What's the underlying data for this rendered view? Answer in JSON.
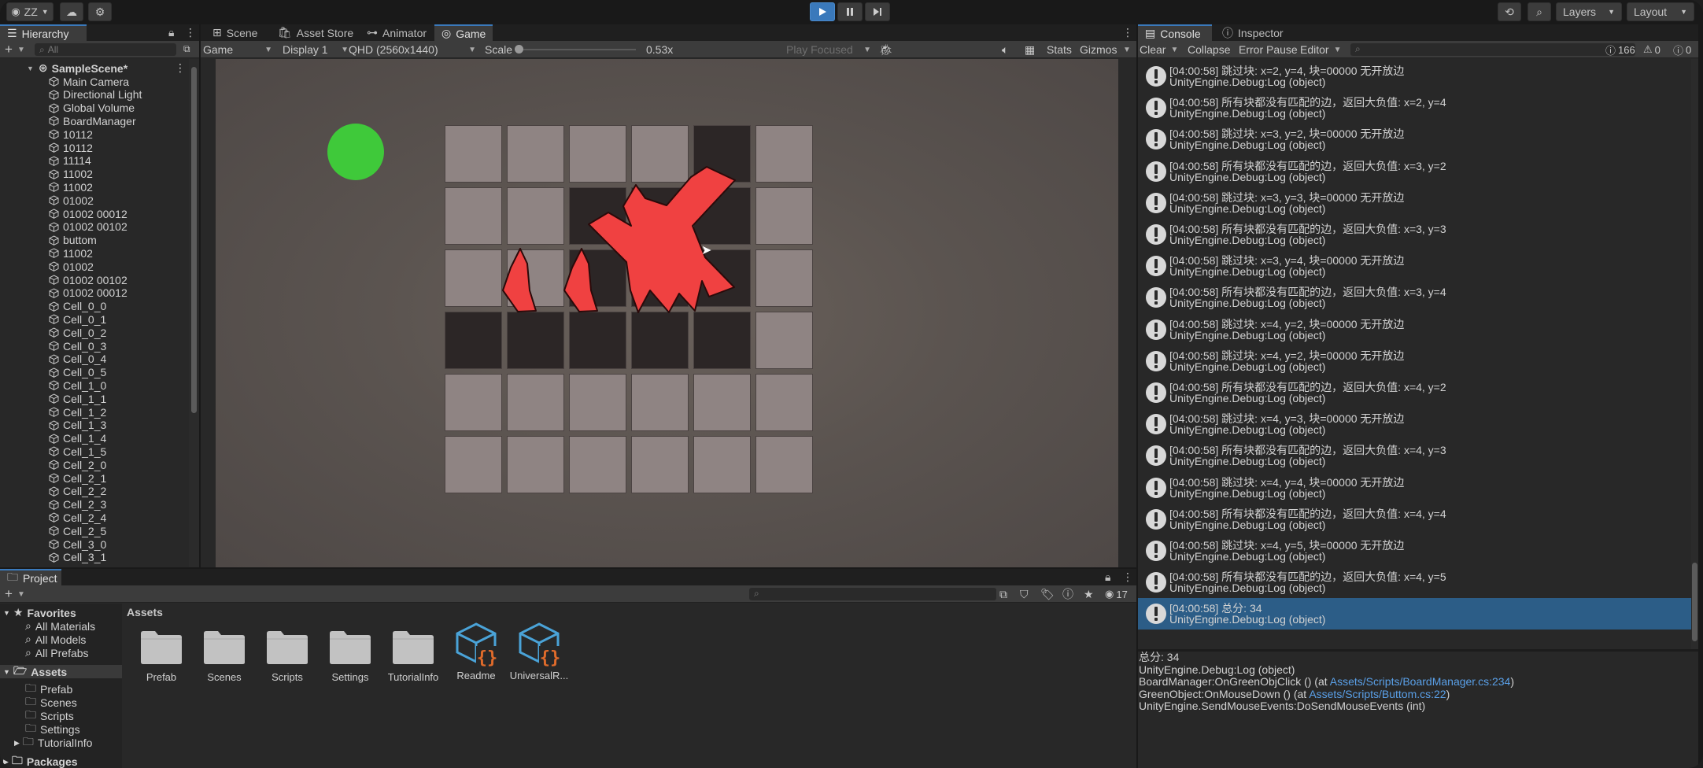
{
  "toolbar": {
    "account_label": "ZZ",
    "layers_label": "Layers",
    "layout_label": "Layout"
  },
  "hierarchy": {
    "tab_label": "Hierarchy",
    "search_placeholder": "All",
    "scene_name": "SampleScene*",
    "items": [
      "Main Camera",
      "Directional Light",
      "Global Volume",
      "BoardManager",
      "10112",
      "10112",
      "11114",
      "11002",
      "11002",
      "01002",
      "01002 00012",
      "01002 00102",
      "buttom",
      "11002",
      "01002",
      "01002 00102",
      "01002 00012",
      "Cell_0_0",
      "Cell_0_1",
      "Cell_0_2",
      "Cell_0_3",
      "Cell_0_4",
      "Cell_0_5",
      "Cell_1_0",
      "Cell_1_1",
      "Cell_1_2",
      "Cell_1_3",
      "Cell_1_4",
      "Cell_1_5",
      "Cell_2_0",
      "Cell_2_1",
      "Cell_2_2",
      "Cell_2_3",
      "Cell_2_4",
      "Cell_2_5",
      "Cell_3_0",
      "Cell_3_1"
    ]
  },
  "center": {
    "tabs": [
      "Scene",
      "Asset Store",
      "Animator",
      "Game"
    ],
    "game_dropdown": "Game",
    "display_dropdown": "Display 1",
    "resolution_dropdown": "QHD (2560x1440)",
    "scale_label": "Scale",
    "scale_value": "0.53x",
    "play_focused": "Play Focused",
    "stats_label": "Stats",
    "gizmos_label": "Gizmos"
  },
  "console": {
    "tabs": [
      "Console",
      "Inspector"
    ],
    "clear_label": "Clear",
    "collapse_label": "Collapse",
    "error_pause_label": "Error Pause",
    "editor_label": "Editor",
    "log_count": "166",
    "warn_count": "0",
    "error_count": "0",
    "logs": [
      {
        "line1": "[04:00:58] 跳过块: x=2, y=4, 块=00000 无开放边",
        "line2": "UnityEngine.Debug:Log (object)"
      },
      {
        "line1": "[04:00:58] 所有块都没有匹配的边，返回大负值: x=2, y=4",
        "line2": "UnityEngine.Debug:Log (object)"
      },
      {
        "line1": "[04:00:58] 跳过块: x=3, y=2, 块=00000 无开放边",
        "line2": "UnityEngine.Debug:Log (object)"
      },
      {
        "line1": "[04:00:58] 所有块都没有匹配的边，返回大负值: x=3, y=2",
        "line2": "UnityEngine.Debug:Log (object)"
      },
      {
        "line1": "[04:00:58] 跳过块: x=3, y=3, 块=00000 无开放边",
        "line2": "UnityEngine.Debug:Log (object)"
      },
      {
        "line1": "[04:00:58] 所有块都没有匹配的边，返回大负值: x=3, y=3",
        "line2": "UnityEngine.Debug:Log (object)"
      },
      {
        "line1": "[04:00:58] 跳过块: x=3, y=4, 块=00000 无开放边",
        "line2": "UnityEngine.Debug:Log (object)"
      },
      {
        "line1": "[04:00:58] 所有块都没有匹配的边，返回大负值: x=3, y=4",
        "line2": "UnityEngine.Debug:Log (object)"
      },
      {
        "line1": "[04:00:58] 跳过块: x=4, y=2, 块=00000 无开放边",
        "line2": "UnityEngine.Debug:Log (object)"
      },
      {
        "line1": "[04:00:58] 跳过块: x=4, y=2, 块=00000 无开放边",
        "line2": "UnityEngine.Debug:Log (object)"
      },
      {
        "line1": "[04:00:58] 所有块都没有匹配的边，返回大负值: x=4, y=2",
        "line2": "UnityEngine.Debug:Log (object)"
      },
      {
        "line1": "[04:00:58] 跳过块: x=4, y=3, 块=00000 无开放边",
        "line2": "UnityEngine.Debug:Log (object)"
      },
      {
        "line1": "[04:00:58] 所有块都没有匹配的边，返回大负值: x=4, y=3",
        "line2": "UnityEngine.Debug:Log (object)"
      },
      {
        "line1": "[04:00:58] 跳过块: x=4, y=4, 块=00000 无开放边",
        "line2": "UnityEngine.Debug:Log (object)"
      },
      {
        "line1": "[04:00:58] 所有块都没有匹配的边，返回大负值: x=4, y=4",
        "line2": "UnityEngine.Debug:Log (object)"
      },
      {
        "line1": "[04:00:58] 跳过块: x=4, y=5, 块=00000 无开放边",
        "line2": "UnityEngine.Debug:Log (object)"
      },
      {
        "line1": "[04:00:58] 所有块都没有匹配的边，返回大负值: x=4, y=5",
        "line2": "UnityEngine.Debug:Log (object)"
      },
      {
        "line1": "[04:00:58] 总分: 34",
        "line2": "UnityEngine.Debug:Log (object)"
      }
    ],
    "detail": {
      "l1": "总分: 34",
      "l2": "UnityEngine.Debug:Log (object)",
      "l3a": "BoardManager:OnGreenObjClick () (at ",
      "l3link": "Assets/Scripts/BoardManager.cs:234",
      "l3b": ")",
      "l4a": "GreenObject:OnMouseDown () (at ",
      "l4link": "Assets/Scripts/Buttom.cs:22",
      "l4b": ")",
      "l5": "UnityEngine.SendMouseEvents:DoSendMouseEvents (int)"
    }
  },
  "project": {
    "tab_label": "Project",
    "hidden_count": "17",
    "favorites_label": "Favorites",
    "favorites": [
      "All Materials",
      "All Models",
      "All Prefabs"
    ],
    "assets_label": "Assets",
    "tree": [
      "Prefab",
      "Scenes",
      "Scripts",
      "Settings",
      "TutorialInfo"
    ],
    "packages_label": "Packages",
    "breadcrumb": "Assets",
    "folders": [
      "Prefab",
      "Scenes",
      "Scripts",
      "Settings",
      "TutorialInfo"
    ],
    "scripts": [
      "Readme",
      "UniversalR..."
    ]
  },
  "colors": {
    "accent": "#3a79bb",
    "selected_row": "#2c5d87",
    "piece": "#f04141",
    "green": "#3fc93a"
  }
}
